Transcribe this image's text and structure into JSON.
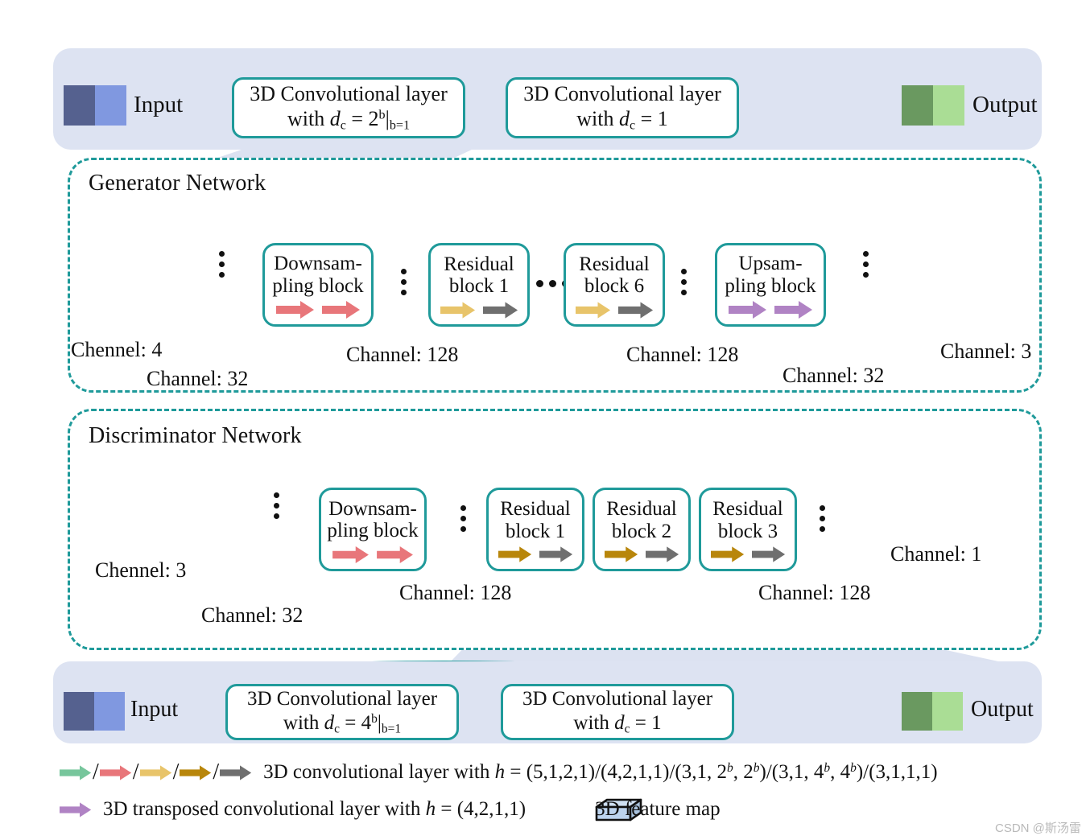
{
  "figure": {
    "watermark": "CSDN @斯汤雷"
  },
  "top_chain": {
    "input_label": "Input",
    "conv1": {
      "line1": "3D Convolutional layer",
      "line2_prefix": "with ",
      "line2_var": "d",
      "line2_sub": "c",
      "line2_eq": " = ",
      "line2_base": "2",
      "line2_sup": "b",
      "line2_bar": "|",
      "line2_cond": "b=1"
    },
    "conv2": {
      "line1": "3D Convolutional layer",
      "line2_prefix": "with ",
      "line2_var": "d",
      "line2_sub": "c",
      "line2_eq": " = ",
      "line2_value": "1"
    },
    "sum_icon": "plus-icon",
    "output_label": "Output",
    "input_colors": [
      "#55618f",
      "#8098e0"
    ],
    "output_colors": [
      "#6a9960",
      "#aadd95"
    ]
  },
  "bottom_chain": {
    "input_label": "Input",
    "conv1": {
      "line1": "3D Convolutional layer",
      "line2_prefix": "with ",
      "line2_var": "d",
      "line2_sub": "c",
      "line2_eq": " = ",
      "line2_base": "4",
      "line2_sup": "b",
      "line2_bar": "|",
      "line2_cond": "b=1"
    },
    "conv2": {
      "line1": "3D Convolutional layer",
      "line2_prefix": "with ",
      "line2_var": "d",
      "line2_sub": "c",
      "line2_eq": " = ",
      "line2_value": "1"
    },
    "sum_icon": "plus-icon",
    "output_label": "Output",
    "input_colors": [
      "#55618f",
      "#8098e0"
    ],
    "output_colors": [
      "#6a9960",
      "#aadd95"
    ]
  },
  "generator": {
    "title": "Generator Network",
    "captions": {
      "input_channel": "Chennel: 4",
      "stage1_channel": "Channel: 32",
      "stage2_channel": "Channel: 128",
      "stage3_channel": "Channel: 128",
      "stage4_channel": "Channel: 32",
      "output_channel": "Channel: 3"
    },
    "blocks": [
      {
        "name": "downsampling-block",
        "line1": "Downsam-",
        "line2": "pling block",
        "arrows": [
          "#e8767a",
          "#e8767a"
        ]
      },
      {
        "name": "residual-block-1",
        "line1": "Residual",
        "line2": "block 1",
        "arrows": [
          "#e8c46a",
          "#6f6f6f"
        ]
      },
      {
        "name": "residual-block-6",
        "line1": "Residual",
        "line2": "block 6",
        "arrows": [
          "#e8c46a",
          "#6f6f6f"
        ]
      },
      {
        "name": "upsampling-block",
        "line1": "Upsam-",
        "line2": "pling block",
        "arrows": [
          "#b083c4",
          "#b083c4"
        ]
      }
    ]
  },
  "discriminator": {
    "title": "Discriminator Network",
    "captions": {
      "input_channel": "Chennel: 3",
      "stage1_channel": "Channel: 32",
      "stage2_channel": "Channel: 128",
      "stage3_channel": "Channel: 128",
      "output_channel": "Channel: 1"
    },
    "blocks": [
      {
        "name": "downsampling-block",
        "line1": "Downsam-",
        "line2": "pling block",
        "arrows": [
          "#e8767a",
          "#e8767a"
        ]
      },
      {
        "name": "residual-block-1",
        "line1": "Residual",
        "line2": "block 1",
        "arrows": [
          "#b8860b",
          "#6f6f6f"
        ]
      },
      {
        "name": "residual-block-2",
        "line1": "Residual",
        "line2": "block 2",
        "arrows": [
          "#b8860b",
          "#6f6f6f"
        ]
      },
      {
        "name": "residual-block-3",
        "line1": "Residual",
        "line2": "block 3",
        "arrows": [
          "#b8860b",
          "#6f6f6f"
        ]
      }
    ]
  },
  "legend": {
    "row1": {
      "arrow_colors": [
        "#77c69c",
        "#e8767a",
        "#e8c46a",
        "#b8860b",
        "#6f6f6f"
      ],
      "separator": "/",
      "text_prefix": "3D convolutional layer with ",
      "var": "h",
      "eq": " = ",
      "specs": [
        "(5,1,2,1)",
        "(4,2,1,1)",
        "(3,1, 2^b, 2^b)",
        "(3,1, 4^b, 4^b)",
        "(3,1,1,1)"
      ],
      "spec1": "(5,1,2,1)",
      "spec2": "(4,2,1,1)",
      "spec3_a": "(3,1, 2",
      "spec3_sup": "b",
      "spec3_b": ", 2",
      "spec3_sup2": "b",
      "spec3_c": ")",
      "spec4_a": "(3,1, 4",
      "spec4_sup": "b",
      "spec4_b": ", 4",
      "spec4_sup2": "b",
      "spec4_c": ")",
      "spec5": "(3,1,1,1)"
    },
    "row2": {
      "arrow_color": "#b083c4",
      "text_prefix": "3D transposed convolutional layer with ",
      "var": "h",
      "eq": " = ",
      "spec": "(4,2,1,1)",
      "feature_map_label": "3D feature map"
    }
  },
  "colors": {
    "panel_blue": "#dde3f2",
    "teal": "#1f9a9a",
    "cuboid_face": "#bcd3ee",
    "cuboid_top": "#cfe0f3",
    "cuboid_side": "#a9c2dd",
    "plus_fill": "#fcd34d",
    "green_arrow": "#77c69c"
  }
}
